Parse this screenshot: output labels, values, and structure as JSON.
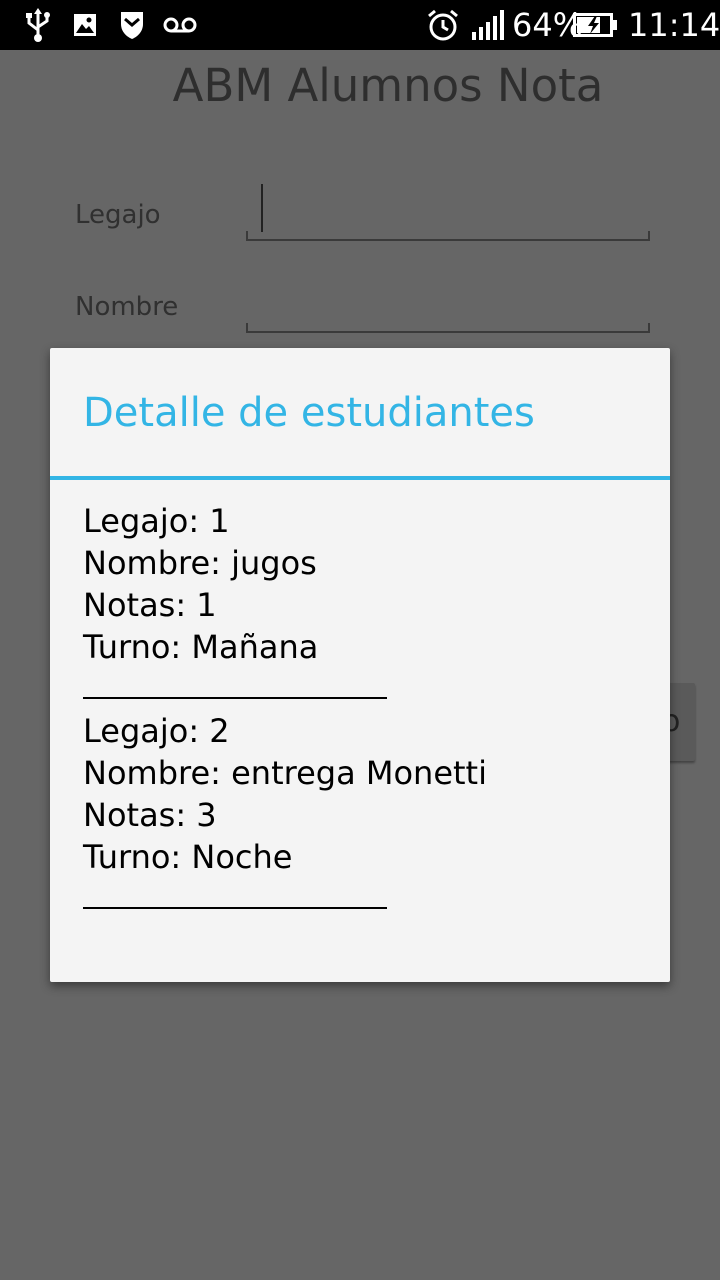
{
  "status_bar": {
    "battery_percent": "64%",
    "time": "11:14",
    "icons": [
      "usb-icon",
      "image-icon",
      "shield-icon",
      "voicemail-icon",
      "alarm-icon",
      "signal-icon",
      "battery-charging-icon"
    ]
  },
  "app": {
    "title": "ABM Alumnos Nota",
    "fields": [
      {
        "label": "Legajo",
        "value": ""
      },
      {
        "label": "Nombre",
        "value": ""
      }
    ],
    "partial_button_text": "o"
  },
  "dialog": {
    "title": "Detalle de estudiantes",
    "students": [
      {
        "legajo": "Legajo: 1",
        "nombre": "Nombre: jugos",
        "notas": "Notas: 1",
        "turno": "Turno: Mañana"
      },
      {
        "legajo": "Legajo: 2",
        "nombre": "Nombre: entrega Monetti",
        "notas": "Notas: 3",
        "turno": "Turno: Noche"
      }
    ]
  },
  "colors": {
    "accent": "#33b5e5",
    "dim_background": "#666666",
    "dialog_background": "#f4f4f4",
    "status_bar": "#000000"
  }
}
